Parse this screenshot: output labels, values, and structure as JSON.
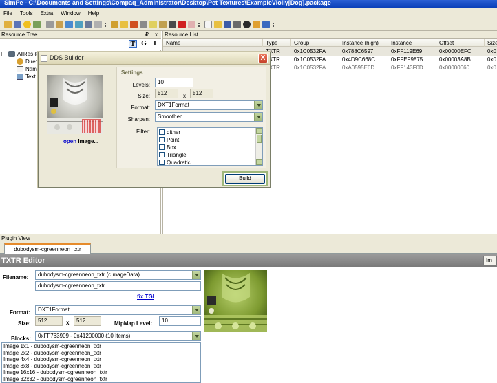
{
  "window": {
    "title": "SimPe - C:\\Documents and Settings\\Compaq_Administrator\\Desktop\\Pet Textures\\ExampleViolly[Dog].package"
  },
  "menu": [
    "File",
    "Tools",
    "Extra",
    "Window",
    "Help"
  ],
  "resource_tree": {
    "title": "Resource Tree",
    "pin": "₽",
    "close": "x",
    "tools": [
      "T",
      "G",
      "I"
    ],
    "items": [
      "AllRes (S)",
      "Direct",
      "Name",
      "Textu"
    ]
  },
  "resource_list": {
    "title": "Resource List",
    "columns": [
      "Name",
      "Type",
      "Group",
      "Instance (high)",
      "Instance",
      "Offset",
      "Size"
    ],
    "rows": [
      {
        "name": "",
        "type": "TXTR",
        "group": "0x1C0532FA",
        "instance_high": "0x788C6597",
        "instance": "0xFF119E69",
        "offset": "0x00000EFC",
        "size": "0x0"
      },
      {
        "name": "",
        "type": "TXTR",
        "group": "0x1C0532FA",
        "instance_high": "0x4D9C668C",
        "instance": "0xFFEF9875",
        "offset": "0x00003A8B",
        "size": "0x0"
      },
      {
        "name": "",
        "type": "TXTR",
        "group": "0x1C0532FA",
        "instance_high": "0xA0595E6D",
        "instance": "0xFF143F0D",
        "offset": "0x00000060",
        "size": "0x0"
      }
    ]
  },
  "plugin_view": {
    "title": "Plugin View",
    "tab": "dubodysm-cgreenneon_txtr"
  },
  "txtr_editor": {
    "title": "TXTR Editor",
    "top_button": "Im",
    "filename_label": "Filename:",
    "filename_combo": "dubodysm-cgreenneon_txtr (cImageData)",
    "filename_value": "dubodysm-cgreenneon_txtr",
    "fix_tgi": "fix TGI",
    "format_label": "Format:",
    "format_value": "DXT1Format",
    "size_label": "Size:",
    "size_w": "512",
    "size_x": "x",
    "size_h": "512",
    "mipmap_label": "MipMap Level:",
    "mipmap_value": "10",
    "blocks_label": "Blocks:",
    "blocks_value": "0xFF763909 - 0x41200000 (10 Items)",
    "images": [
      "Image 1x1 - dubodysm-cgreenneon_txtr",
      "Image 2x2 - dubodysm-cgreenneon_txtr",
      "Image 4x4 - dubodysm-cgreenneon_txtr",
      "Image 8x8 - dubodysm-cgreenneon_txtr",
      "Image 16x16 - dubodysm-cgreenneon_txtr",
      "Image 32x32 - dubodysm-cgreenneon_txtr"
    ]
  },
  "dds_builder": {
    "title": "DDS Builder",
    "close": "X",
    "open_link": "open",
    "open_suffix": " Image...",
    "settings_title": "Settings",
    "levels_label": "Levels:",
    "levels_value": "10",
    "size_label": "Size:",
    "size_w": "512",
    "size_x": "x",
    "size_h": "512",
    "format_label": "Format:",
    "format_value": "DXT1Format",
    "sharpen_label": "Sharpen:",
    "sharpen_value": "Smoothen",
    "filter_label": "Filter:",
    "filters": [
      "dither",
      "Point",
      "Box",
      "Triangle",
      "Quadratic"
    ],
    "build_label": "Build"
  },
  "colors": {
    "titlebar": "#0a3fb8",
    "chrome": "#ece9d8",
    "link": "#0000cc",
    "accent_green": "#9fb77a",
    "editor_bar": "#8a8a8a"
  }
}
